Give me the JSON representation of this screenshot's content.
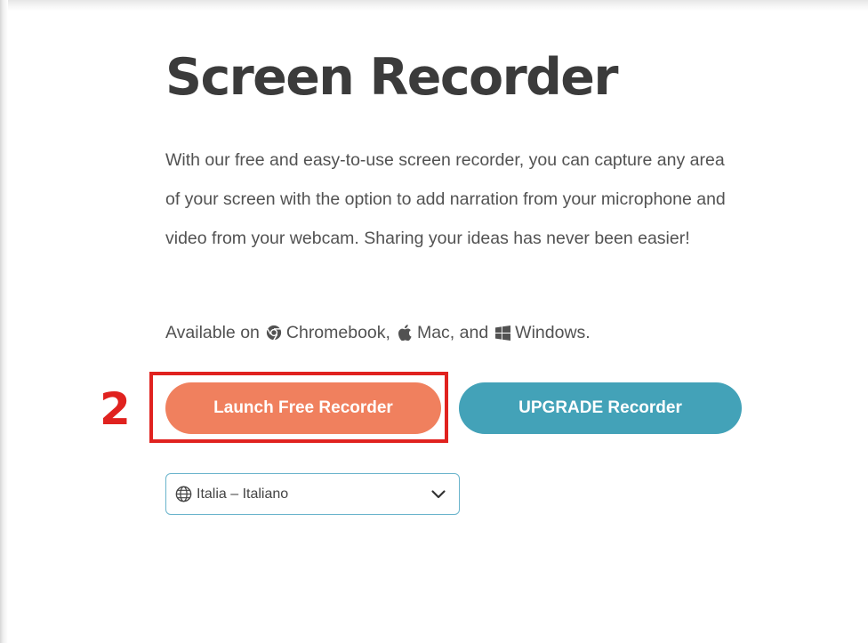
{
  "page": {
    "title": "Screen Recorder",
    "description": "With our free and easy-to-use screen recorder, you can capture any area of your screen with the option to add narration from your microphone and video from your webcam. Sharing your ideas has never been easier!",
    "availability": {
      "prefix": "Available on",
      "chromebook": "Chromebook,",
      "mac": "Mac, and",
      "windows": "Windows.",
      "icons": [
        "chrome-icon",
        "apple-icon",
        "windows-icon"
      ]
    }
  },
  "annotation": {
    "step_number": "2",
    "color": "#e0221f"
  },
  "buttons": {
    "launch_label": "Launch Free Recorder",
    "launch_color": "#f0805e",
    "upgrade_label": "UPGRADE Recorder",
    "upgrade_color": "#43a2b8"
  },
  "language_select": {
    "value": "Italia – Italiano",
    "icon": "globe-icon",
    "border_color": "#6ab4cc"
  }
}
